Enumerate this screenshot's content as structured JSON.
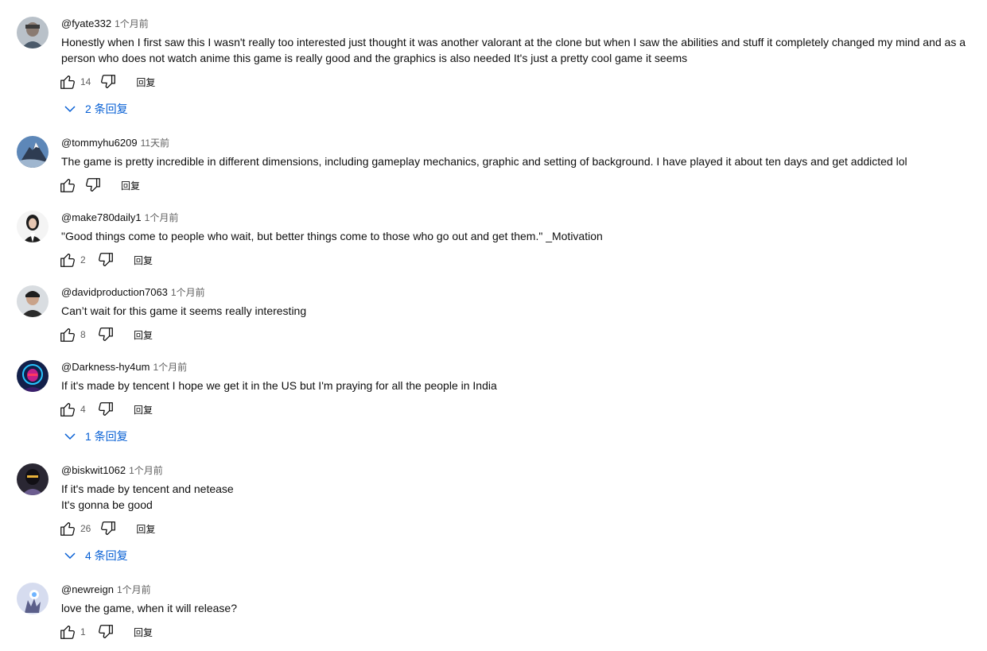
{
  "comments": [
    {
      "author": "@fyate332",
      "time": "1个月前",
      "text": "Honestly when I first saw this I wasn't really too interested just thought it was another valorant at the clone but when I saw the abilities and stuff it completely changed my mind and as a person who does not watch anime this game is really good and the graphics is also needed It's just a pretty cool game it seems",
      "likes": "14",
      "reply_label": "回复",
      "replies_label": "2 条回复"
    },
    {
      "author": "@tommyhu6209",
      "time": "11天前",
      "text": "The game is pretty incredible in different dimensions, including gameplay mechanics, graphic and setting of background. I have played it about ten days and get addicted lol",
      "likes": "",
      "reply_label": "回复"
    },
    {
      "author": "@make780daily1",
      "time": "1个月前",
      "text": "\"Good things come to people who wait, but better things come to those who go out and get them.\" _Motivation",
      "likes": "2",
      "reply_label": "回复"
    },
    {
      "author": "@davidproduction7063",
      "time": "1个月前",
      "text": "Can’t wait for this game it seems really interesting",
      "likes": "8",
      "reply_label": "回复"
    },
    {
      "author": "@Darkness-hy4um",
      "time": "1个月前",
      "text": "If it's made by tencent I hope we get it in the US but I'm praying for all the people in India",
      "likes": "4",
      "reply_label": "回复",
      "replies_label": "1 条回复"
    },
    {
      "author": "@biskwit1062",
      "time": "1个月前",
      "text": "If it's made by tencent and netease\nIt's gonna be good",
      "likes": "26",
      "reply_label": "回复",
      "replies_label": "4 条回复"
    },
    {
      "author": "@newreign",
      "time": "1个月前",
      "text": "love the game, when it will release?",
      "likes": "1",
      "reply_label": "回复"
    }
  ],
  "colors": {
    "link_blue": "#065fd4",
    "secondary_text": "#606060",
    "primary_text": "#0f0f0f"
  },
  "icons": {
    "like": "thumb-up-icon",
    "dislike": "thumb-down-icon",
    "replies": "chevron-down-icon"
  }
}
